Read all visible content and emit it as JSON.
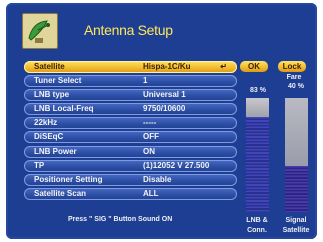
{
  "header": {
    "title": "Antenna Setup",
    "icon": "dish-antenna-icon"
  },
  "menu": {
    "items": [
      {
        "label": "Satellite",
        "value": "Hispa-1C/Ku",
        "selected": true
      },
      {
        "label": "Tuner Select",
        "value": "1"
      },
      {
        "label": "LNB type",
        "value": "Universal 1"
      },
      {
        "label": "LNB Local-Freq",
        "value": "9750/10600"
      },
      {
        "label": "22kHz",
        "value": "-----"
      },
      {
        "label": "DiSEqC",
        "value": "OFF"
      },
      {
        "label": "LNB Power",
        "value": "ON"
      },
      {
        "label": "TP",
        "value": "(1)12052 V 27.500"
      },
      {
        "label": "Positioner Setting",
        "value": "Disable"
      },
      {
        "label": "Satellite Scan",
        "value": "ALL"
      }
    ],
    "selected_arrow": "↵"
  },
  "hint": "Press \" SIG \" Button Sound ON",
  "status": {
    "ok_label": "OK",
    "lock_label": "Lock",
    "fare_label": "Fare"
  },
  "meters": {
    "lnb": {
      "percent_text": "83 %",
      "level": 0.83,
      "caption_line1": "LNB &",
      "caption_line2": "Conn."
    },
    "signal": {
      "percent_text": "40 %",
      "level": 0.4,
      "caption_line1": "Signal",
      "caption_line2": "Satellite"
    }
  },
  "colors": {
    "background": "#1e3e93",
    "title": "#ffe85a",
    "selected": "#f0b92a",
    "row": "#2c4fa7"
  }
}
